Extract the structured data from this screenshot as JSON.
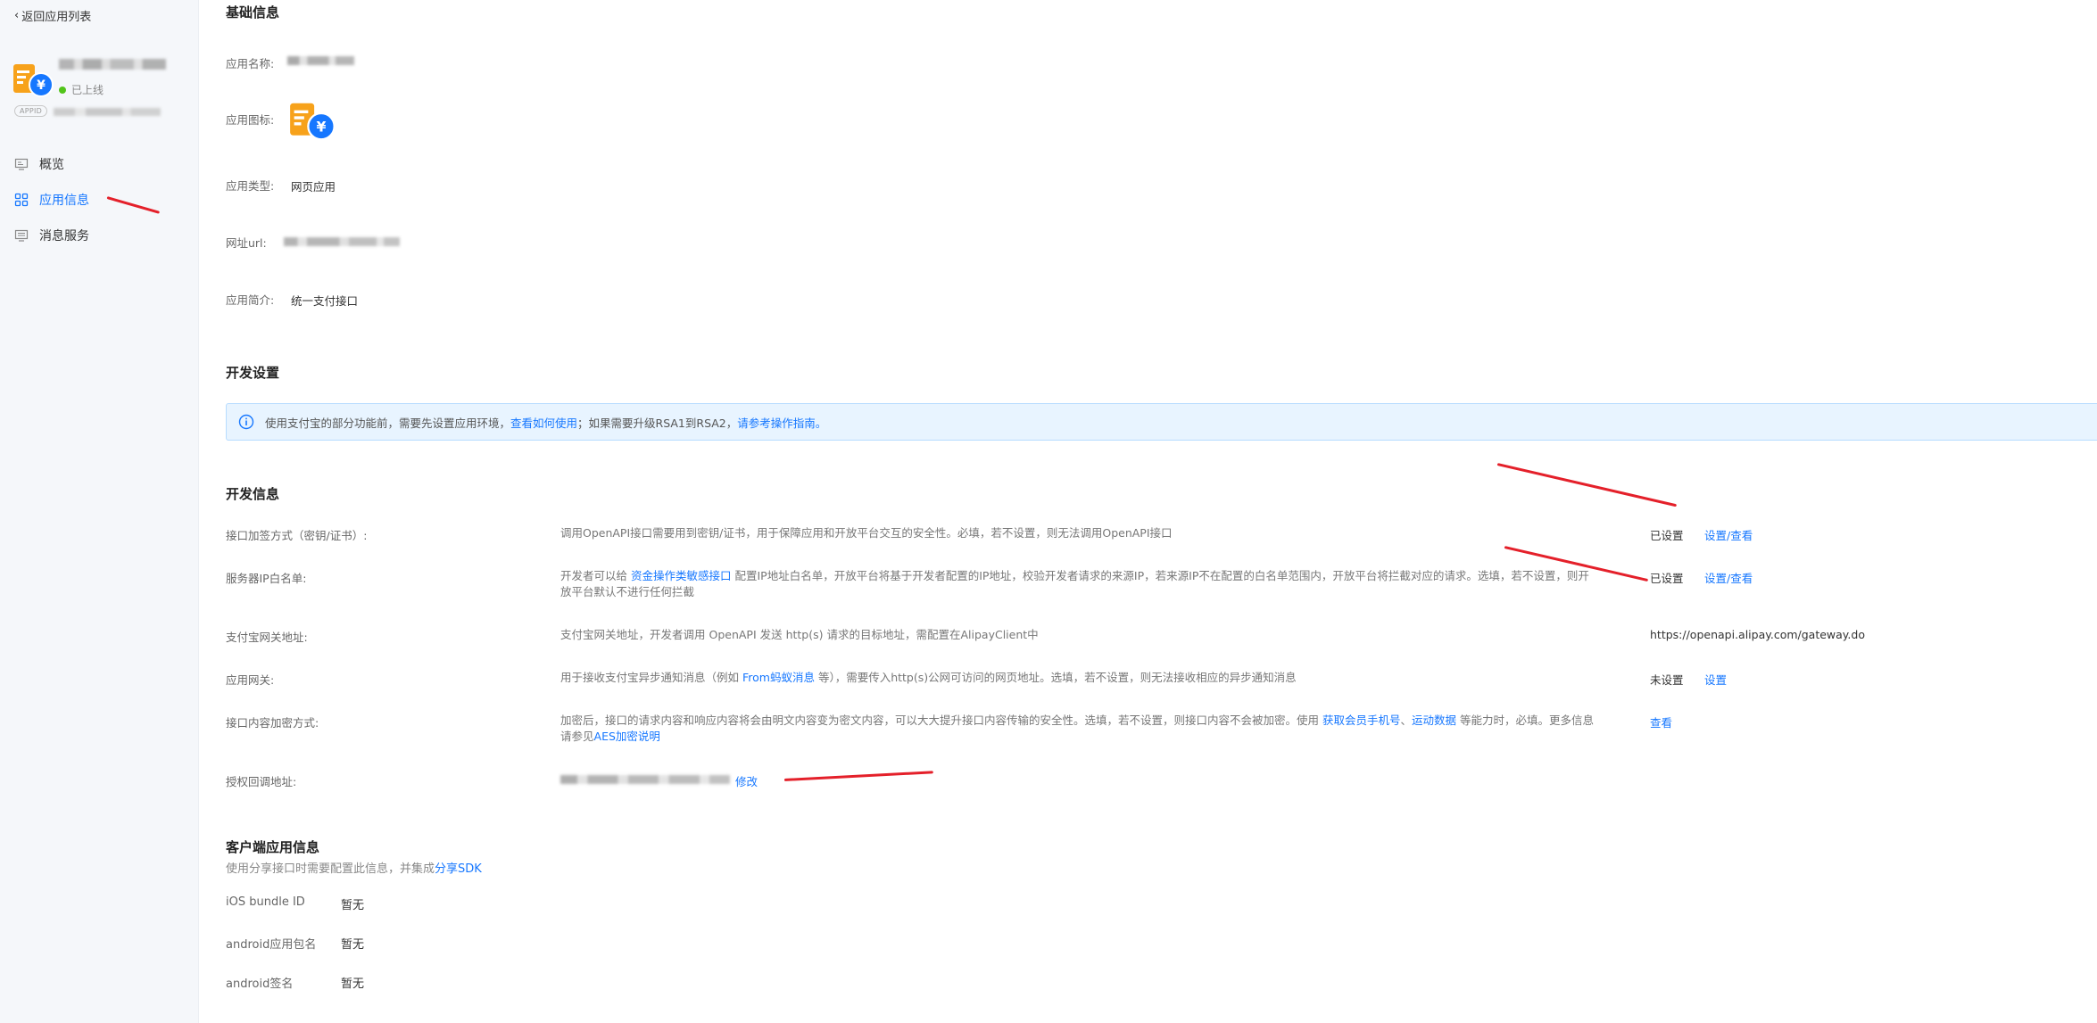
{
  "sidebar": {
    "back_label": "返回应用列表",
    "app": {
      "status_label": "已上线",
      "status_color": "#52c41a",
      "appid_tag": "APPID"
    },
    "items": [
      {
        "label": "概览",
        "icon": "monitor-icon",
        "active": false
      },
      {
        "label": "应用信息",
        "icon": "grid-icon",
        "active": true
      },
      {
        "label": "消息服务",
        "icon": "message-icon",
        "active": false
      }
    ]
  },
  "basic": {
    "title": "基础信息",
    "name_label": "应用名称:",
    "icon_label": "应用图标:",
    "type_label": "应用类型:",
    "type_value": "网页应用",
    "url_label": "网址url:",
    "intro_label": "应用简介:",
    "intro_value": "统一支付接口"
  },
  "dev_settings": {
    "title": "开发设置",
    "banner_pre": "使用支付宝的部分功能前，需要先设置应用环境，",
    "banner_link1": "查看如何使用",
    "banner_mid": "；如果需要升级RSA1到RSA2，",
    "banner_link2": "请参考操作指南。"
  },
  "dev_info": {
    "title": "开发信息",
    "rows": [
      {
        "label": "接口加签方式（密钥/证书）:",
        "desc": "调用OpenAPI接口需要用到密钥/证书，用于保障应用和开放平台交互的安全性。必填，若不设置，则无法调用OpenAPI接口",
        "status": "已设置",
        "action": "设置/查看"
      },
      {
        "label": "服务器IP白名单:",
        "desc_pre": "开发者可以给 ",
        "desc_link": "资金操作类敏感接口",
        "desc_post": " 配置IP地址白名单，开放平台将基于开发者配置的IP地址，校验开发者请求的来源IP，若来源IP不在配置的白名单范围内，开放平台将拦截对应的请求。选填，若不设置，则开放平台默认不进行任何拦截",
        "status": "已设置",
        "action": "设置/查看"
      },
      {
        "label": "支付宝网关地址:",
        "desc": "支付宝网关地址，开发者调用 OpenAPI 发送 http(s) 请求的目标地址，需配置在AlipayClient中",
        "value": "https://openapi.alipay.com/gateway.do"
      },
      {
        "label": "应用网关:",
        "desc_pre": "用于接收支付宝异步通知消息（例如 ",
        "desc_link": "From蚂蚁消息",
        "desc_post": " 等），需要传入http(s)公网可访问的网页地址。选填，若不设置，则无法接收相应的异步通知消息",
        "status": "未设置",
        "action": "设置"
      },
      {
        "label": "接口内容加密方式:",
        "desc_pre": "加密后，接口的请求内容和响应内容将会由明文内容变为密文内容，可以大大提升接口内容传输的安全性。选填，若不设置，则接口内容不会被加密。使用 ",
        "desc_link1": "获取会员手机号",
        "desc_sep": "、",
        "desc_link2": "运动数据",
        "desc_mid": " 等能力时，必填。更多信息请参见",
        "desc_link3": "AES加密说明",
        "action": "查看"
      },
      {
        "label": "授权回调地址:",
        "action": "修改"
      }
    ]
  },
  "client": {
    "title": "客户端应用信息",
    "desc_pre": "使用分享接口时需要配置此信息，并集成",
    "desc_link": "分享SDK",
    "rows": [
      {
        "label": "iOS bundle ID",
        "value": "暂无"
      },
      {
        "label": "android应用包名",
        "value": "暂无"
      },
      {
        "label": "android签名",
        "value": "暂无"
      }
    ]
  },
  "colors": {
    "primary": "#1677ff",
    "annotation": "#e4202a"
  }
}
